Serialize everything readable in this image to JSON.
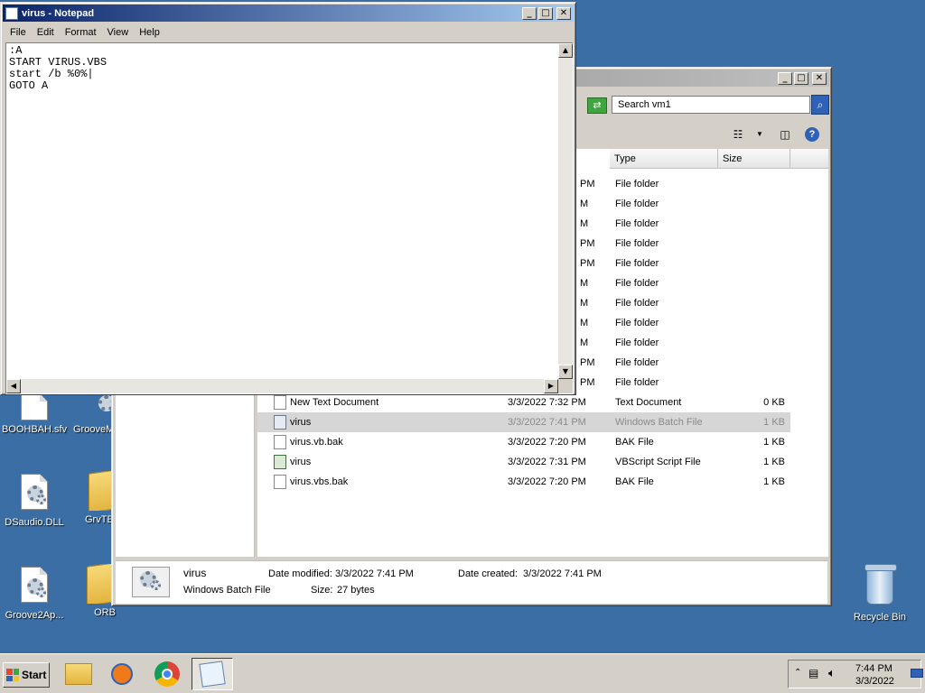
{
  "notepad": {
    "title": "virus - Notepad",
    "menu": [
      "File",
      "Edit",
      "Format",
      "View",
      "Help"
    ],
    "content": ":A\nSTART VIRUS.VBS\nstart /b %0%|\nGOTO A"
  },
  "explorer": {
    "search_placeholder": "Search vm1",
    "columns": {
      "type": "Type",
      "size": "Size"
    },
    "folder_rows": [
      {
        "date": "PM",
        "type": "File folder"
      },
      {
        "date": "M",
        "type": "File folder"
      },
      {
        "date": "M",
        "type": "File folder"
      },
      {
        "date": "PM",
        "type": "File folder"
      },
      {
        "date": "PM",
        "type": "File folder"
      },
      {
        "date": "M",
        "type": "File folder"
      },
      {
        "date": "M",
        "type": "File folder"
      },
      {
        "date": "M",
        "type": "File folder"
      },
      {
        "date": "M",
        "type": "File folder"
      },
      {
        "date": "PM",
        "type": "File folder"
      },
      {
        "date": "PM",
        "type": "File folder"
      }
    ],
    "files": [
      {
        "name": "New Text Document",
        "date": "3/3/2022 7:32 PM",
        "type": "Text Document",
        "size": "0 KB",
        "icon": "text-document-icon"
      },
      {
        "name": "virus",
        "date": "3/3/2022 7:41 PM",
        "type": "Windows Batch File",
        "size": "1 KB",
        "icon": "batch-file-icon"
      },
      {
        "name": "virus.vb.bak",
        "date": "3/3/2022 7:20 PM",
        "type": "BAK File",
        "size": "1 KB",
        "icon": "bak-file-icon"
      },
      {
        "name": "virus",
        "date": "3/3/2022 7:31 PM",
        "type": "VBScript Script File",
        "size": "1 KB",
        "icon": "vbscript-file-icon"
      },
      {
        "name": "virus.vbs.bak",
        "date": "3/3/2022 7:20 PM",
        "type": "BAK File",
        "size": "1 KB",
        "icon": "bak-file-icon"
      }
    ],
    "details": {
      "name": "virus",
      "type": "Windows Batch File",
      "modified_label": "Date modified:",
      "modified_value": "3/3/2022 7:41 PM",
      "created_label": "Date created:",
      "created_value": "3/3/2022 7:41 PM",
      "size_label": "Size:",
      "size_value": "27 bytes"
    }
  },
  "desktop": {
    "icons": [
      {
        "label": "BOOHBAH.sfv"
      },
      {
        "label": "GrooveM"
      },
      {
        "label": "DSaudio.DLL"
      },
      {
        "label": "GrvTE"
      },
      {
        "label": "Groove2Ap..."
      },
      {
        "label": "ORB"
      },
      {
        "label": "Recycle Bin"
      }
    ]
  },
  "taskbar": {
    "start_label": "Start",
    "time": "7:44 PM",
    "date": "3/3/2022"
  },
  "colors": {
    "desktop": "#3a6ea5",
    "title_active": "#0a246a",
    "selected_row": "#d6d6d6"
  }
}
